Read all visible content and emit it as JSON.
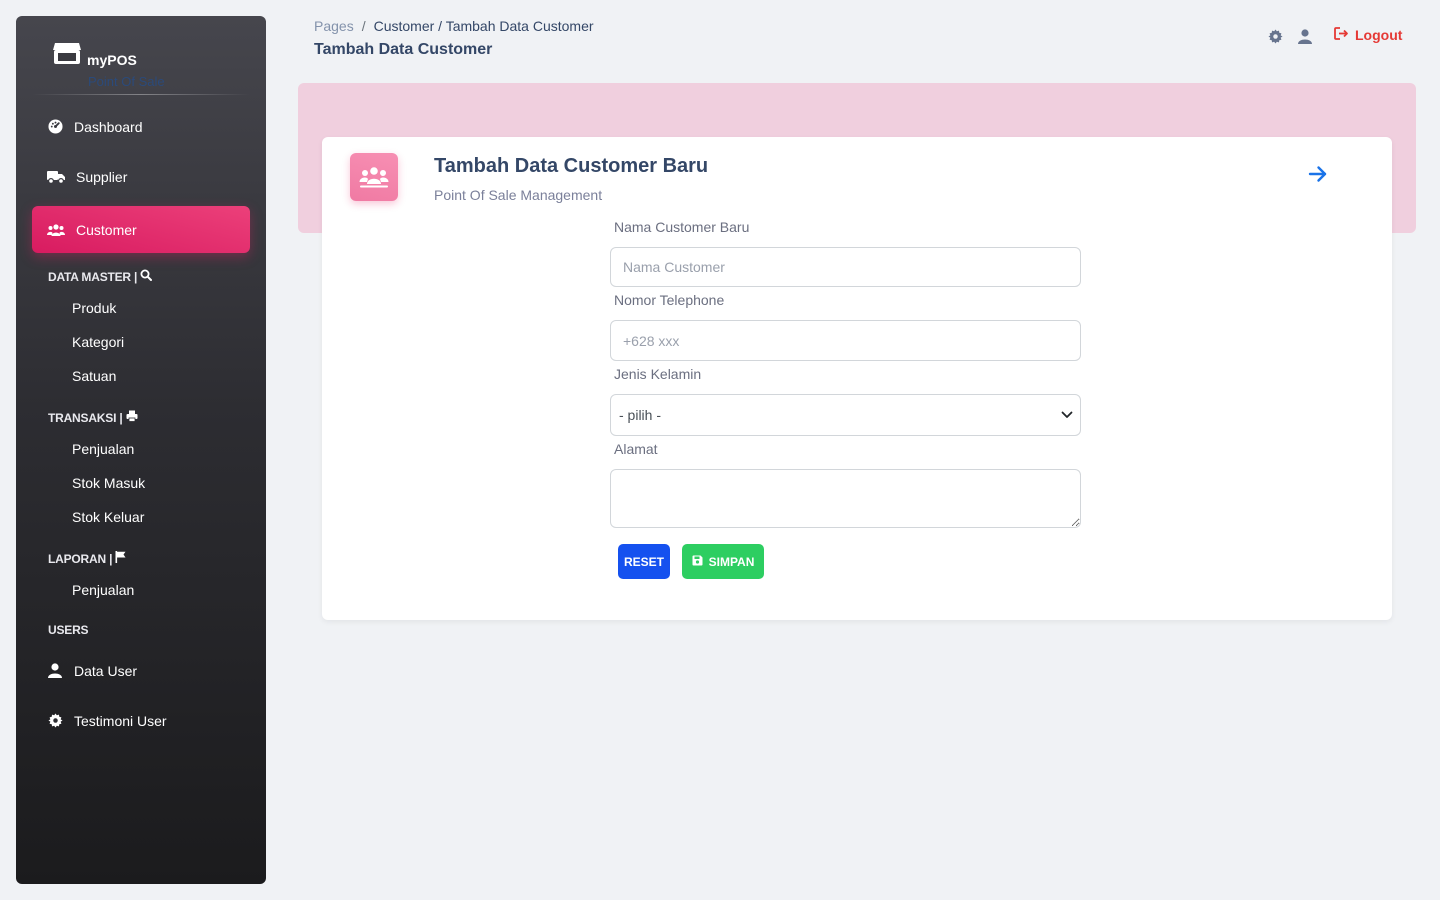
{
  "sidebar": {
    "brand": {
      "name": "myPOS",
      "subtitle": "Point Of Sale"
    },
    "main_items": [
      {
        "label": "Dashboard",
        "icon": "dashboard-gauge-icon"
      },
      {
        "label": "Supplier",
        "icon": "truck-icon"
      },
      {
        "label": "Customer",
        "icon": "users-icon",
        "active": true
      }
    ],
    "sections": [
      {
        "title": "DATA MASTER |",
        "icon": "search-icon",
        "items": [
          "Produk",
          "Kategori",
          "Satuan"
        ]
      },
      {
        "title": "TRANSAKSI |",
        "icon": "printer-icon",
        "items": [
          "Penjualan",
          "Stok Masuk",
          "Stok Keluar"
        ]
      },
      {
        "title": "LAPORAN |",
        "icon": "flag-icon",
        "items": [
          "Penjualan"
        ]
      },
      {
        "title": "USERS",
        "icon": "",
        "items": []
      }
    ],
    "user_items": [
      {
        "label": "Data User",
        "icon": "user-icon"
      },
      {
        "label": "Testimoni User",
        "icon": "gear-icon"
      }
    ]
  },
  "header": {
    "breadcrumb": [
      "Pages",
      "/",
      "Customer / Tambah Data Customer"
    ],
    "title": "Tambah Data Customer",
    "logout_label": "Logout"
  },
  "card": {
    "title": "Tambah Data Customer Baru",
    "subtitle": "Point Of Sale Management",
    "fields": {
      "nama": {
        "label": "Nama Customer Baru",
        "placeholder": "Nama Customer",
        "value": ""
      },
      "telepon": {
        "label": "Nomor Telephone",
        "placeholder": "+628 xxx",
        "value": ""
      },
      "kelamin": {
        "label": "Jenis Kelamin",
        "selected": "- pilih -"
      },
      "alamat": {
        "label": "Alamat",
        "value": ""
      }
    },
    "buttons": {
      "reset": "RESET",
      "save": "SIMPAN"
    }
  },
  "colors": {
    "accent_pink": "#e91e63",
    "band_pink": "#f0cfde",
    "reset_blue": "#1551ef",
    "save_green": "#2dce61",
    "logout_red": "#e53935",
    "arrow_blue": "#1a73e8"
  }
}
